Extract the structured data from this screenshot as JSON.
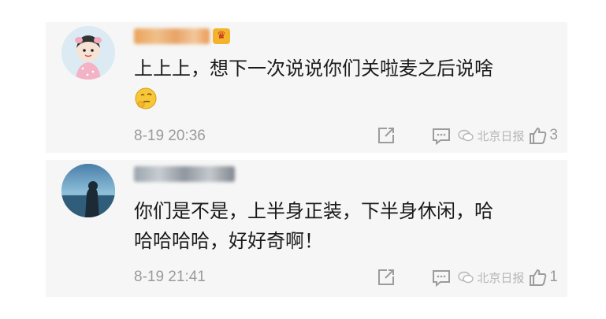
{
  "comments": [
    {
      "content": "上上上，想下一次说说你们关啦麦之后说啥",
      "time": "8-19 20:36",
      "likes": "3",
      "watermark": "北京日报",
      "avatar": "cartoon-girl-avatar",
      "badge_icon": "crown-badge-icon"
    },
    {
      "content_line1": "你们是不是，上半身正装，下半身休闲，哈",
      "content_line2": "哈哈哈哈，好好奇啊！",
      "time": "8-19 21:41",
      "likes": "1",
      "watermark": "北京日报",
      "avatar": "photo-avatar"
    }
  ],
  "colors": {
    "card_bg": "#f6f6f6",
    "text": "#1a1a1a",
    "meta": "#9a9a9a"
  }
}
